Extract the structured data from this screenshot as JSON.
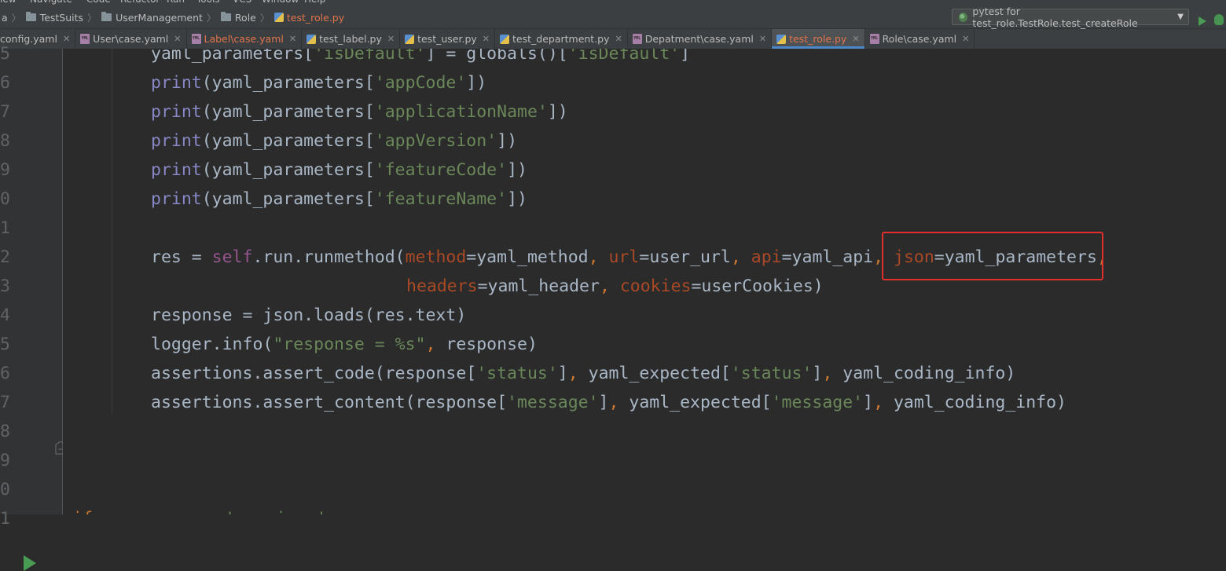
{
  "menu": {
    "items": [
      "iew",
      "Navigate",
      "Code",
      "Refactor",
      "Run",
      "Tools",
      "VCS",
      "Window",
      "Help"
    ]
  },
  "breadcrumb": {
    "items": [
      "a",
      "TestSuits",
      "UserManagement",
      "Role",
      "test_role.py"
    ]
  },
  "run_config": {
    "label": "pytest for test_role.TestRole.test_createRole"
  },
  "tabs": [
    {
      "label": "config.yaml",
      "type": "yaml",
      "modified": false,
      "active": false
    },
    {
      "label": "User\\case.yaml",
      "type": "yaml",
      "modified": false,
      "active": false
    },
    {
      "label": "Label\\case.yaml",
      "type": "yaml",
      "modified": true,
      "active": false
    },
    {
      "label": "test_label.py",
      "type": "py",
      "modified": false,
      "active": false
    },
    {
      "label": "test_user.py",
      "type": "py",
      "modified": false,
      "active": false
    },
    {
      "label": "test_department.py",
      "type": "py",
      "modified": false,
      "active": false
    },
    {
      "label": "Depatment\\case.yaml",
      "type": "yaml",
      "modified": false,
      "active": false
    },
    {
      "label": "test_role.py",
      "type": "py",
      "modified": true,
      "active": true
    },
    {
      "label": "Role\\case.yaml",
      "type": "yaml",
      "modified": false,
      "active": false
    }
  ],
  "editor": {
    "lines": [
      {
        "num": "5",
        "indent": "body",
        "tokens": [
          [
            "plain",
            "yaml_parameters["
          ],
          [
            "str",
            "'isDefault'"
          ],
          [
            "plain",
            "] = globals()["
          ],
          [
            "str",
            "'isDefault'"
          ],
          [
            "plain",
            "]"
          ]
        ]
      },
      {
        "num": "6",
        "indent": "body",
        "tokens": [
          [
            "builtin",
            "print"
          ],
          [
            "plain",
            "(yaml_parameters["
          ],
          [
            "str",
            "'appCode'"
          ],
          [
            "plain",
            "])"
          ]
        ]
      },
      {
        "num": "7",
        "indent": "body",
        "tokens": [
          [
            "builtin",
            "print"
          ],
          [
            "plain",
            "(yaml_parameters["
          ],
          [
            "str",
            "'applicationName'"
          ],
          [
            "plain",
            "])"
          ]
        ]
      },
      {
        "num": "8",
        "indent": "body",
        "tokens": [
          [
            "builtin",
            "print"
          ],
          [
            "plain",
            "(yaml_parameters["
          ],
          [
            "str",
            "'appVersion'"
          ],
          [
            "plain",
            "])"
          ]
        ]
      },
      {
        "num": "9",
        "indent": "body",
        "tokens": [
          [
            "builtin",
            "print"
          ],
          [
            "plain",
            "(yaml_parameters["
          ],
          [
            "str",
            "'featureCode'"
          ],
          [
            "plain",
            "])"
          ]
        ]
      },
      {
        "num": "0",
        "indent": "body",
        "tokens": [
          [
            "builtin",
            "print"
          ],
          [
            "plain",
            "(yaml_parameters["
          ],
          [
            "str",
            "'featureName'"
          ],
          [
            "plain",
            "])"
          ]
        ]
      },
      {
        "num": "1",
        "indent": "body",
        "tokens": []
      },
      {
        "num": "2",
        "indent": "body",
        "tokens": [
          [
            "plain",
            "res = "
          ],
          [
            "self",
            "self"
          ],
          [
            "plain",
            ".run.runmethod("
          ],
          [
            "param",
            "method"
          ],
          [
            "plain",
            "=yaml_method"
          ],
          [
            "kw",
            ", "
          ],
          [
            "param",
            "url"
          ],
          [
            "plain",
            "=user_url"
          ],
          [
            "kw",
            ", "
          ],
          [
            "param",
            "api"
          ],
          [
            "plain",
            "=yaml_api"
          ],
          [
            "kw",
            ", "
          ],
          [
            "param",
            "json"
          ],
          [
            "plain",
            "=yaml_parameters"
          ],
          [
            "kw",
            ","
          ]
        ]
      },
      {
        "num": "3",
        "indent": "cont",
        "tokens": [
          [
            "param",
            "headers"
          ],
          [
            "plain",
            "=yaml_header"
          ],
          [
            "kw",
            ", "
          ],
          [
            "param",
            "cookies"
          ],
          [
            "plain",
            "=userCookies)"
          ]
        ]
      },
      {
        "num": "4",
        "indent": "body",
        "tokens": [
          [
            "plain",
            "response = json.loads(res.text)"
          ]
        ]
      },
      {
        "num": "5",
        "indent": "body",
        "tokens": [
          [
            "plain",
            "logger.info("
          ],
          [
            "str",
            "\"response = %s\""
          ],
          [
            "kw",
            ", "
          ],
          [
            "plain",
            "response)"
          ]
        ]
      },
      {
        "num": "6",
        "indent": "body",
        "tokens": [
          [
            "plain",
            "assertions.assert_code(response["
          ],
          [
            "str",
            "'status'"
          ],
          [
            "plain",
            "]"
          ],
          [
            "kw",
            ", "
          ],
          [
            "plain",
            "yaml_expected["
          ],
          [
            "str",
            "'status'"
          ],
          [
            "plain",
            "]"
          ],
          [
            "kw",
            ", "
          ],
          [
            "plain",
            "yaml_coding_info)"
          ]
        ]
      },
      {
        "num": "7",
        "indent": "body",
        "tokens": [
          [
            "plain",
            "assertions.assert_content(response["
          ],
          [
            "str",
            "'message'"
          ],
          [
            "plain",
            "]"
          ],
          [
            "kw",
            ", "
          ],
          [
            "plain",
            "yaml_expected["
          ],
          [
            "str",
            "'message'"
          ],
          [
            "plain",
            "]"
          ],
          [
            "kw",
            ", "
          ],
          [
            "plain",
            "yaml_coding_info)"
          ]
        ]
      },
      {
        "num": "8",
        "indent": "body",
        "tokens": []
      },
      {
        "num": "9",
        "indent": "body",
        "tokens": []
      },
      {
        "num": "0",
        "indent": "body",
        "tokens": []
      },
      {
        "num": "1",
        "indent": "main",
        "tokens": [
          [
            "kw",
            "if"
          ],
          [
            "plain",
            " __name__ == "
          ],
          [
            "str",
            "'__main__'"
          ],
          [
            "plain",
            ":"
          ]
        ]
      }
    ]
  },
  "colors": {
    "background": "#2b2b2b",
    "string": "#6a8759",
    "builtin": "#8888c6",
    "keyword": "#cc7832",
    "self": "#94558d",
    "param": "#aa4926",
    "highlight_box": "#e0302e"
  }
}
